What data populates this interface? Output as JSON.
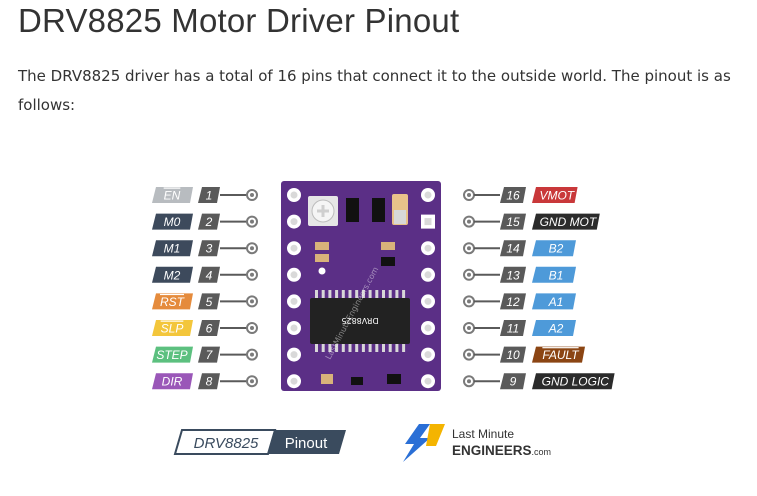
{
  "heading": "DRV8825 Motor Driver Pinout",
  "intro": "The DRV8825 driver has a total of 16 pins that connect it to the outside world. The pinout is as follows:",
  "board": {
    "chip_label": "DRV8825",
    "silkscreen": "LastMinuteEngineers.com",
    "color": "#5b2f86"
  },
  "left_pins": [
    {
      "label": "EN",
      "number": "1",
      "color": "#b8bcc0",
      "overline": true
    },
    {
      "label": "M0",
      "number": "2",
      "color": "#3d4a5c",
      "overline": false
    },
    {
      "label": "M1",
      "number": "3",
      "color": "#3d4a5c",
      "overline": false
    },
    {
      "label": "M2",
      "number": "4",
      "color": "#3d4a5c",
      "overline": false
    },
    {
      "label": "RST",
      "number": "5",
      "color": "#e58b3c",
      "overline": true
    },
    {
      "label": "SLP",
      "number": "6",
      "color": "#f3c63b",
      "overline": true
    },
    {
      "label": "STEP",
      "number": "7",
      "color": "#5cc07f",
      "overline": false
    },
    {
      "label": "DIR",
      "number": "8",
      "color": "#9a57b8",
      "overline": false
    }
  ],
  "right_pins": [
    {
      "label": "VMOT",
      "number": "16",
      "color": "#c9383a",
      "overline": false
    },
    {
      "label": "GND MOT",
      "number": "15",
      "color": "#2b2b2b",
      "overline": false
    },
    {
      "label": "B2",
      "number": "14",
      "color": "#4e9ad9",
      "overline": false
    },
    {
      "label": "B1",
      "number": "13",
      "color": "#4e9ad9",
      "overline": false
    },
    {
      "label": "A1",
      "number": "12",
      "color": "#4e9ad9",
      "overline": false
    },
    {
      "label": "A2",
      "number": "11",
      "color": "#4e9ad9",
      "overline": false
    },
    {
      "label": "FAULT",
      "number": "10",
      "color": "#8b4513",
      "overline": true
    },
    {
      "label": "GND LOGIC",
      "number": "9",
      "color": "#2b2b2b",
      "overline": false
    }
  ],
  "caption": {
    "part": "DRV8825",
    "word": "Pinout"
  },
  "logo": {
    "line1": "Last Minute",
    "line2": "ENGINEERS",
    "suffix": ".com",
    "accent": "#f4b400",
    "bolt_color": "#2a6fd6"
  },
  "colors": {
    "number_box": "#5a5a5a",
    "wire": "#5a5a5a",
    "pin_ring": "#7a7a7a"
  }
}
